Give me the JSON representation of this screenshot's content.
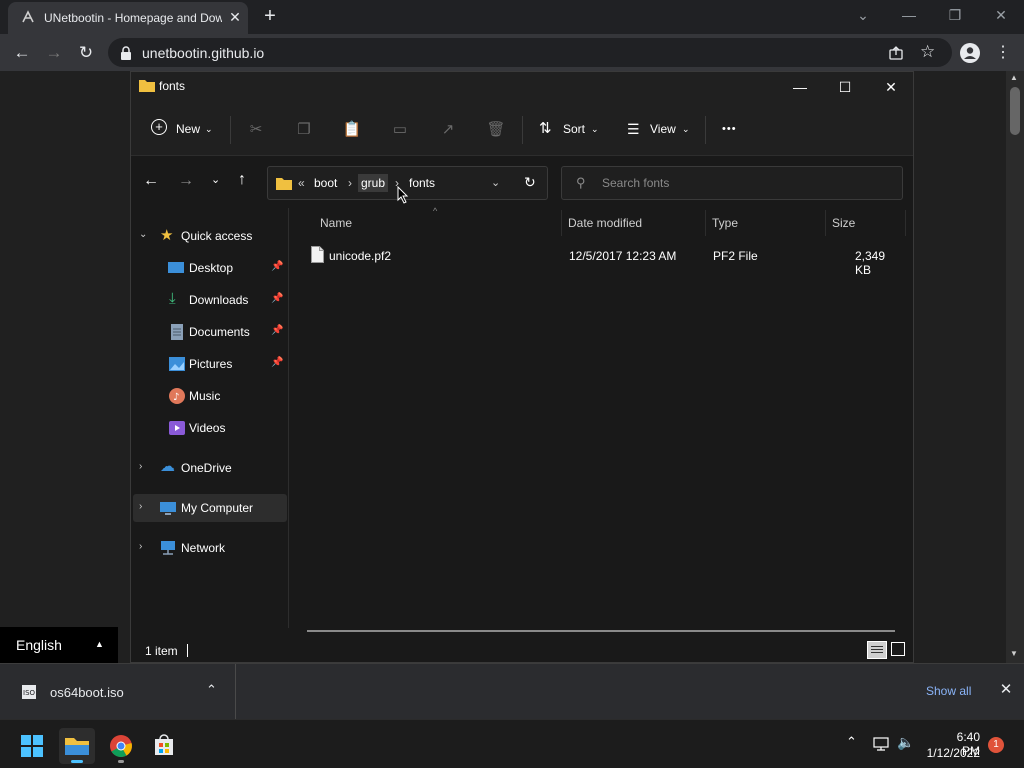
{
  "browser": {
    "tab_title": "UNetbootin - Homepage and Downloads",
    "tab_close": "✕",
    "new_tab": "+",
    "url": "unetbootin.github.io",
    "controls": {
      "minimize": "—",
      "restore": "❐",
      "close": "✕",
      "tabsearch": "⌄"
    }
  },
  "explorer": {
    "title": "fonts",
    "window_controls": {
      "minimize": "—",
      "maximize": "☐",
      "close": "✕"
    },
    "commands": {
      "new": "New",
      "sort": "Sort",
      "view": "View",
      "more": "•••"
    },
    "breadcrumb": {
      "overflow": "«",
      "parts": [
        "boot",
        "grub",
        "fonts"
      ]
    },
    "search_placeholder": "Search fonts",
    "nav": {
      "quick_access": "Quick access",
      "items": [
        "Desktop",
        "Downloads",
        "Documents",
        "Pictures",
        "Music",
        "Videos"
      ],
      "onedrive": "OneDrive",
      "my_computer": "My Computer",
      "network": "Network"
    },
    "columns": [
      "Name",
      "Date modified",
      "Type",
      "Size"
    ],
    "files": [
      {
        "name": "unicode.pf2",
        "date": "12/5/2017 12:23 AM",
        "type": "PF2 File",
        "size": "2,349 KB"
      }
    ],
    "status": "1 item"
  },
  "language": "English",
  "download": {
    "file": "os64boot.iso",
    "show_all": "Show all"
  },
  "taskbar": {
    "time": "6:40 PM",
    "date": "1/12/2022",
    "notifications": "1"
  },
  "colors": {
    "accent_folder": "#f0c040",
    "link": "#8ab4f8",
    "badge": "#e0533a"
  }
}
